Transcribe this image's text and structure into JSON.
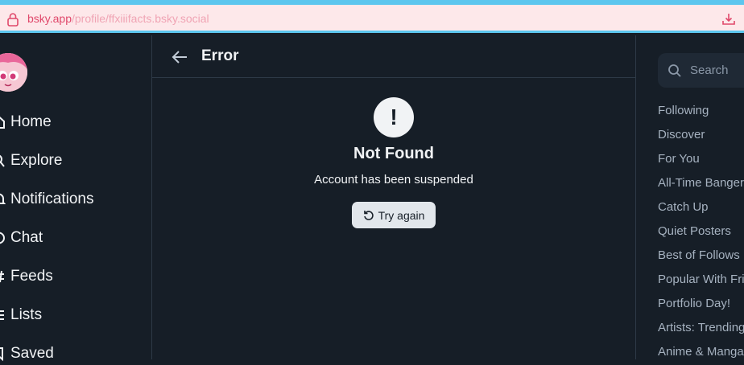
{
  "browser": {
    "url_host": "bsky.app",
    "url_path": "/profile/ffxiiifacts.bsky.social"
  },
  "sidebar": {
    "items": [
      {
        "label": "Home",
        "icon": "home-icon"
      },
      {
        "label": "Explore",
        "icon": "search-icon"
      },
      {
        "label": "Notifications",
        "icon": "bell-icon"
      },
      {
        "label": "Chat",
        "icon": "chat-icon"
      },
      {
        "label": "Feeds",
        "icon": "hashtag-icon"
      },
      {
        "label": "Lists",
        "icon": "list-icon"
      },
      {
        "label": "Saved",
        "icon": "bookmark-icon"
      }
    ]
  },
  "header": {
    "title": "Error"
  },
  "error": {
    "icon": "!",
    "title": "Not Found",
    "message": "Account has been suspended",
    "retry_label": "Try again"
  },
  "search": {
    "placeholder": "Search"
  },
  "feeds": [
    "Following",
    "Discover",
    "For You",
    "All-Time Bangers",
    "Catch Up",
    "Quiet Posters",
    "Best of Follows",
    "Popular With Friends",
    "Portfolio Day!",
    "Artists: Trending",
    "Anime & Manga"
  ],
  "colors": {
    "background": "#161e27",
    "accent": "#5cc6ee",
    "url_host": "#e0486b"
  }
}
